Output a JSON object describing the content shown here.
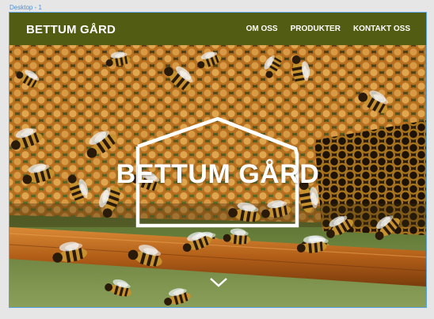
{
  "artboard": {
    "label": "Desktop - 1"
  },
  "header": {
    "brand": "BETTUM GÅRD",
    "menu": [
      {
        "label": "OM OSS"
      },
      {
        "label": "PRODUKTER"
      },
      {
        "label": "KONTAKT OSS"
      }
    ]
  },
  "hero": {
    "logo_text": "BETTUM GÅRD",
    "scroll_icon": "chevron-down-icon",
    "image": "bees-on-honeycomb"
  },
  "colors": {
    "navbar": "#535c13",
    "text": "#ffffff",
    "honeycomb": "#c98a2e",
    "wood": "#b8651e"
  }
}
